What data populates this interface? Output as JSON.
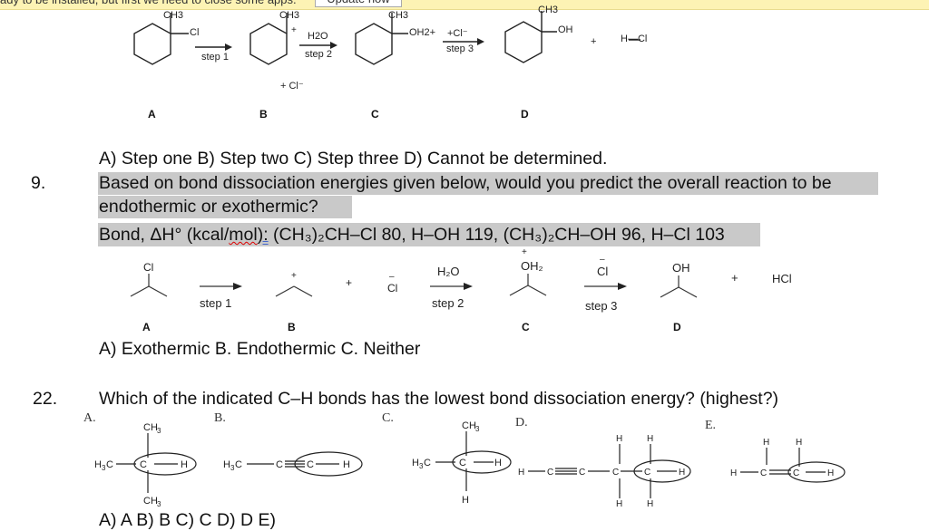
{
  "notification": {
    "text": "ady to be installed, but first we need to close some apps.",
    "button_label": "Update now"
  },
  "reaction1": {
    "compounds": {
      "A": {
        "sub_top": "CH3",
        "sub_right": "Cl"
      },
      "B": {
        "sub_top": "CH3",
        "charge": "+"
      },
      "C": {
        "sub_top": "CH3",
        "sub_right": "OH2+"
      },
      "D": {
        "sub_top": "CH3",
        "sub_right": "OH"
      }
    },
    "steps": [
      {
        "above": "",
        "below": "step 1"
      },
      {
        "above": "H2O",
        "below": "step 2"
      },
      {
        "above": "+Cl⁻",
        "below": "step 3"
      }
    ],
    "byproduct_b": "+ Cl⁻",
    "plus": "+",
    "product_extra": "H—Cl",
    "labels": [
      "A",
      "B",
      "C",
      "D"
    ]
  },
  "q8_options": "A) Step one    B) Step two    C) Step three   D) Cannot be determined.",
  "q9": {
    "number": "9.",
    "line1": "Based on bond dissociation energies given below, would you predict the overall reaction to be",
    "line2": "endothermic or exothermic?",
    "line3_prefix": "Bond, ΔH° (kcal/",
    "line3_mol": "mol",
    "line3_colon": "):",
    "line3_rest": " (CH₃)₂CH–Cl  80,  H–OH  119,  (CH₃)₂CH–OH  96,  H–Cl 103",
    "reaction": {
      "A_sub": "Cl",
      "B_charge": "+",
      "plus": "+",
      "cl_anion": "Cl",
      "cl_charge": "–",
      "step2_above": "H₂O",
      "step2_below": "step 2",
      "step1_below": "step 1",
      "C_sub": "OH₂",
      "C_charge": "+",
      "step3_above": "Cl",
      "step3_charge": "–",
      "step3_below": "step 3",
      "D_sub": "OH",
      "plus2": "+",
      "hcl": "HCl",
      "labels": [
        "A",
        "B",
        "C",
        "D"
      ]
    },
    "options": "A) Exothermic   B. Endothermic   C. Neither"
  },
  "q22": {
    "number": "22.",
    "question": "Which of the indicated C–H bonds has the lowest bond dissociation energy?  (highest?)",
    "structure_labels": [
      "A.",
      "B.",
      "C.",
      "D.",
      "E."
    ],
    "options": "A) A    B) B    C) C    D) D    E)"
  }
}
